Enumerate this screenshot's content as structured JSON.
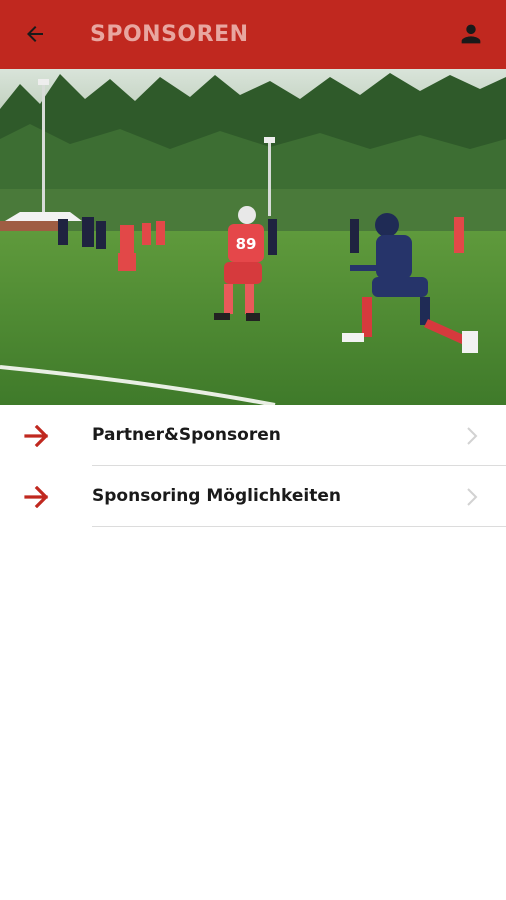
{
  "appbar": {
    "title": "SPONSOREN",
    "background_color": "#c0281f",
    "back_icon": "arrow-left-icon",
    "profile_icon": "person-icon"
  },
  "hero": {
    "player_number": "89"
  },
  "menu": {
    "items": [
      {
        "label": "Partner&Sponsoren",
        "icon": "arrow-right-icon"
      },
      {
        "label": "Sponsoring Möglichkeiten",
        "icon": "arrow-right-icon"
      }
    ],
    "accent_color": "#c0281f"
  }
}
